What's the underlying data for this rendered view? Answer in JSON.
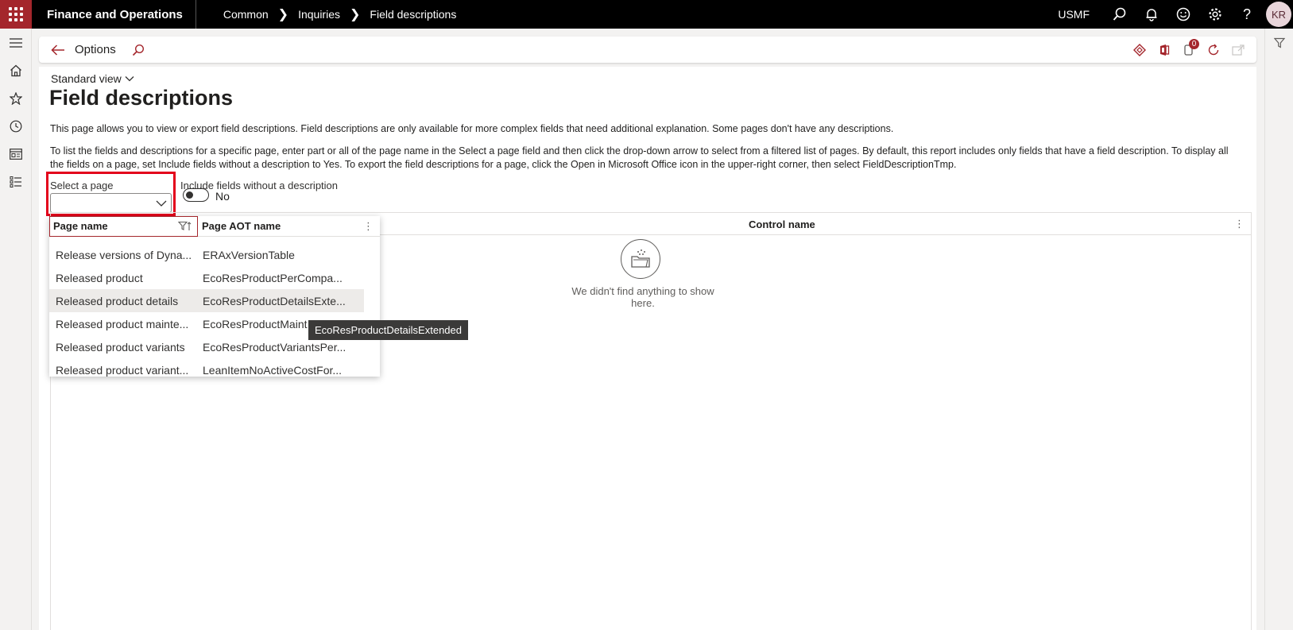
{
  "topbar": {
    "app_title": "Finance and Operations",
    "breadcrumbs": [
      "Common",
      "Inquiries",
      "Field descriptions"
    ],
    "company": "USMF",
    "avatar_initials": "KR"
  },
  "actionpane": {
    "title": "Options",
    "notification_count": "0"
  },
  "page": {
    "view_name": "Standard view",
    "title": "Field descriptions",
    "description_1": "This page allows you to view or export field descriptions. Field descriptions are only available for more complex fields that need additional explanation. Some pages don't have any descriptions.",
    "description_2": "To list the fields and descriptions for a specific page, enter part or all of the page name in the Select a page field and then click the drop-down arrow to select from a filtered list of pages. By default, this report includes only fields that have a field description. To display all the fields on a page, set Include fields without a description to Yes. To export the field descriptions for a page, click the Open in Microsoft Office icon in the upper-right corner, then select FieldDescriptionTmp."
  },
  "filters": {
    "select_page_label": "Select a page",
    "select_page_value": "",
    "include_label": "Include fields without a description",
    "include_value": "No"
  },
  "grid": {
    "columns": [
      "Control name"
    ],
    "empty_text": "We didn't find anything to show here."
  },
  "dropdown": {
    "columns": [
      "Page name",
      "Page AOT name"
    ],
    "rows": [
      {
        "name": "Release versions of Dyna...",
        "aot": "ERAxVersionTable"
      },
      {
        "name": "Released product",
        "aot": "EcoResProductPerCompa..."
      },
      {
        "name": "Released product details",
        "aot": "EcoResProductDetailsExte..."
      },
      {
        "name": "Released product mainte...",
        "aot": "EcoResProductMaint"
      },
      {
        "name": "Released product variants",
        "aot": "EcoResProductVariantsPer..."
      },
      {
        "name": "Released product variant...",
        "aot": "LeanItemNoActiveCostFor..."
      }
    ],
    "tooltip": "EcoResProductDetailsExtended"
  }
}
